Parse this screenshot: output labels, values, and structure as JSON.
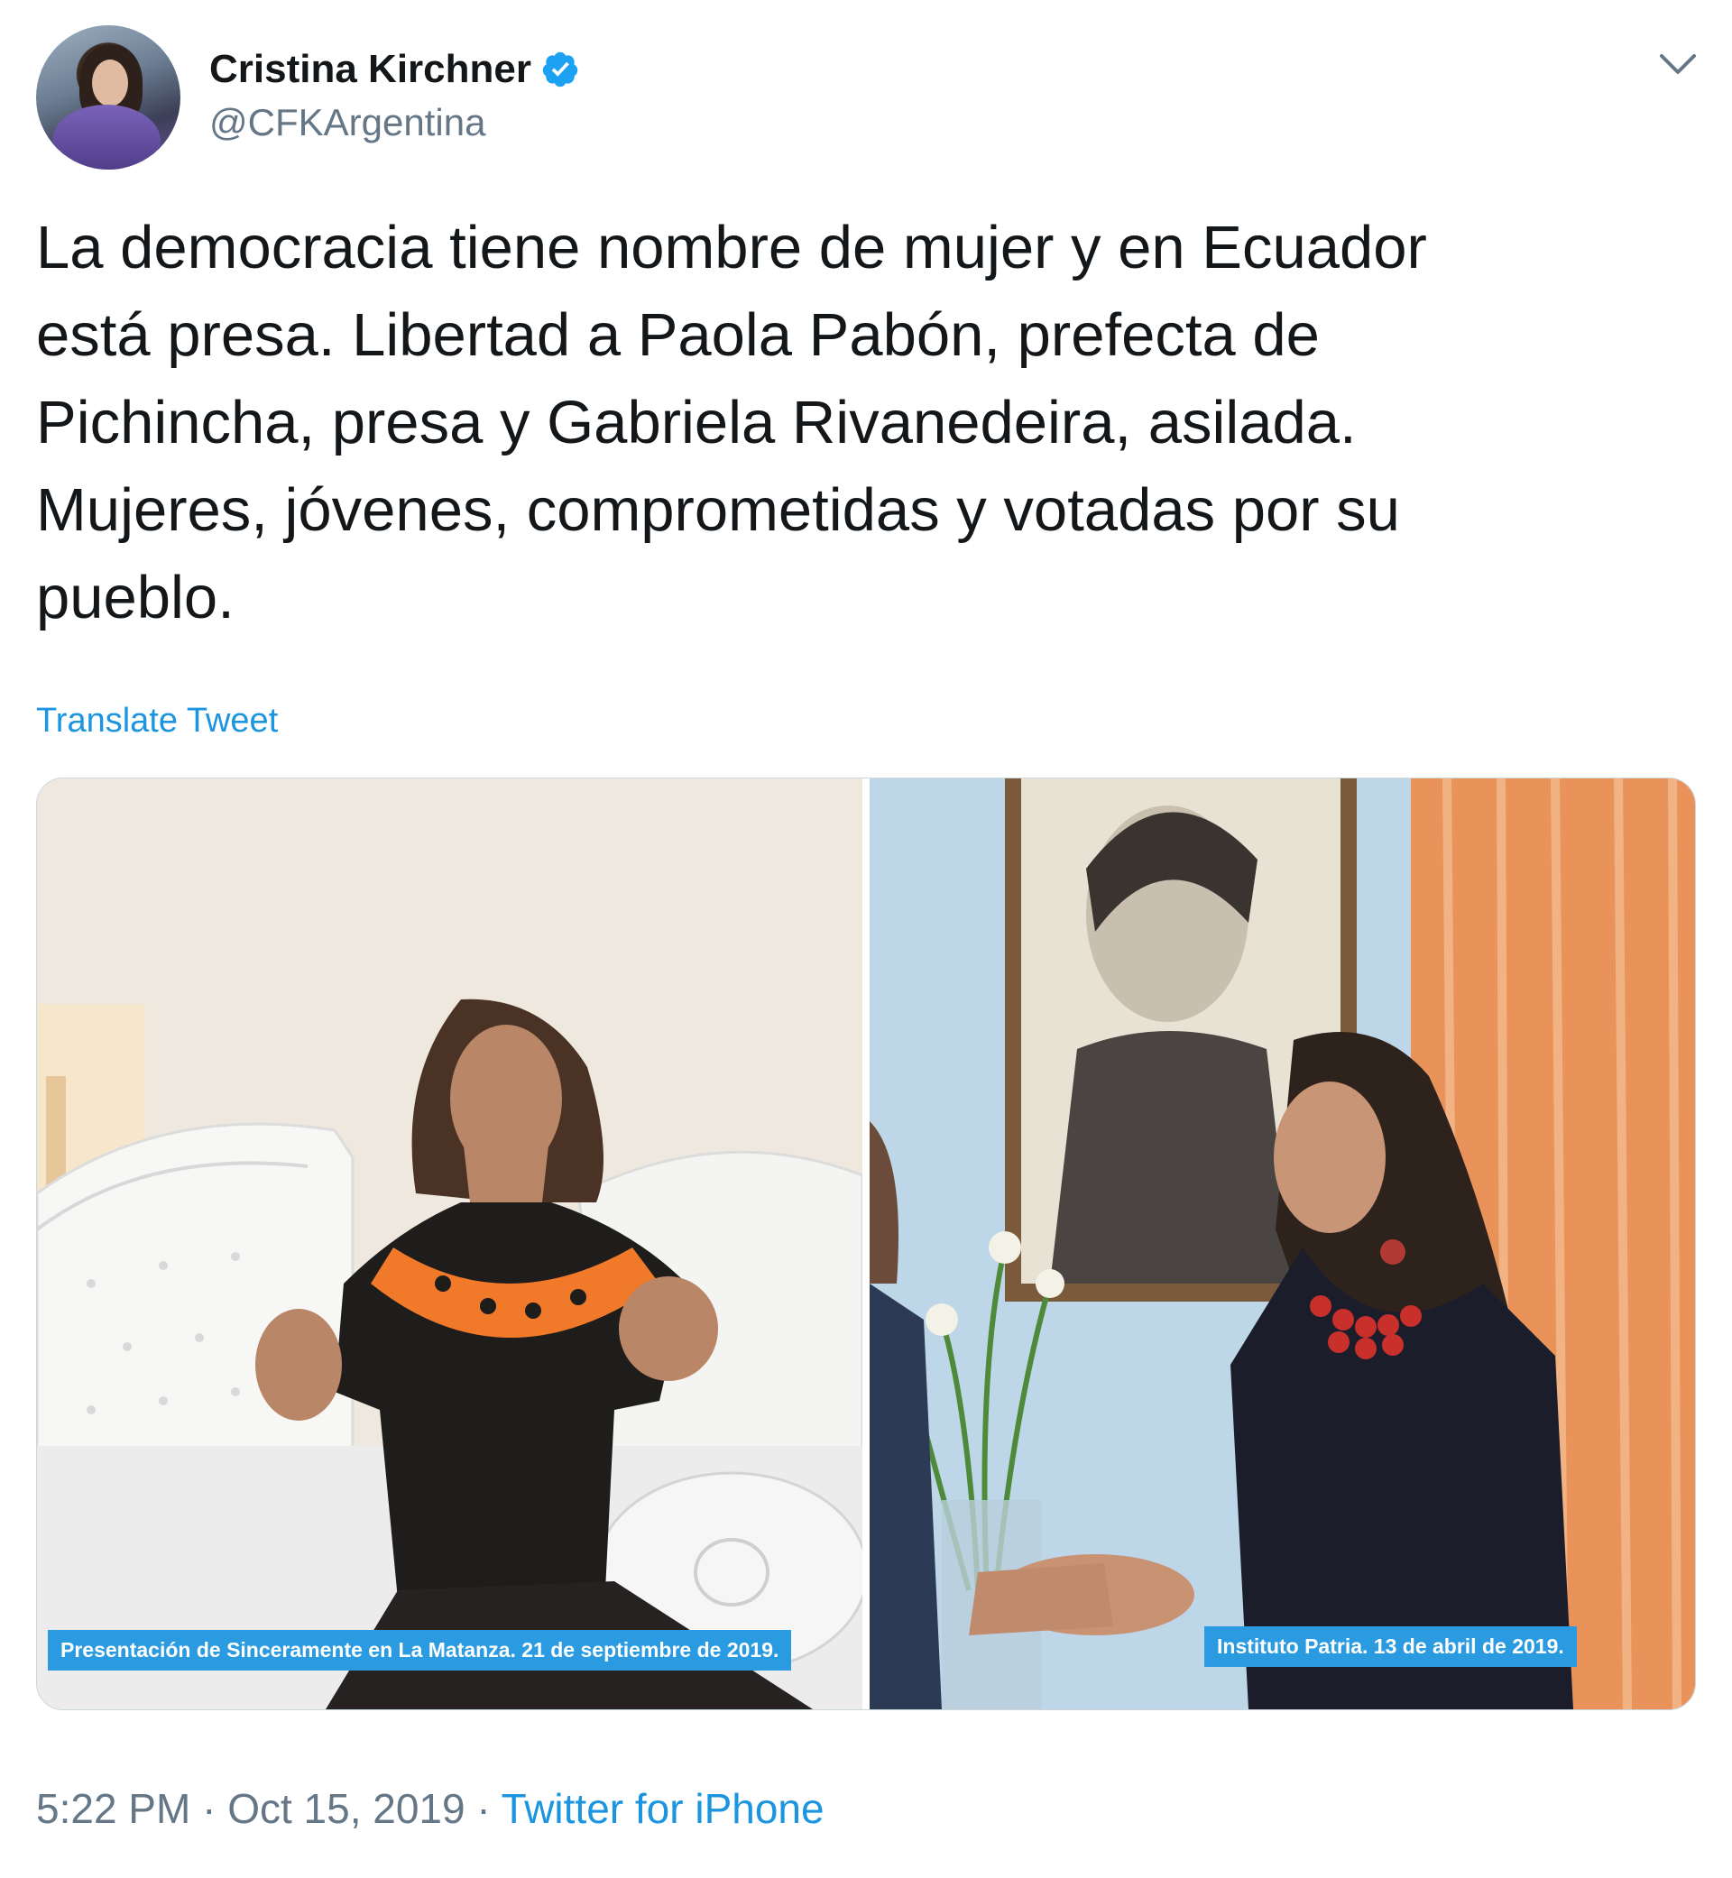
{
  "tweet": {
    "author": {
      "display_name": "Cristina Kirchner",
      "handle": "@CFKArgentina",
      "verified": true,
      "avatar": "profile-photo"
    },
    "text": "La democracia tiene nombre de mujer y en Ecuador\nestá presa. Libertad a Paola Pabón, prefecta de\nPichincha, presa y Gabriela Rivanedeira, asilada.\nMujeres, jóvenes, comprometidas y votadas por su\npueblo.",
    "translate_label": "Translate Tweet",
    "media": [
      {
        "caption": "Presentación de Sinceramente en La Matanza. 21 de septiembre de 2019."
      },
      {
        "caption": "Instituto Patria. 13 de abril de 2019."
      }
    ],
    "timestamp": "5:22 PM · Oct 15, 2019",
    "separator": " · ",
    "source": "Twitter for iPhone",
    "menu_icon": "chevron-down-icon"
  },
  "colors": {
    "link": "#1b95e0",
    "secondary_text": "#657786",
    "verified_badge": "#1da1f2",
    "caption_bg": "#2a9be0"
  }
}
